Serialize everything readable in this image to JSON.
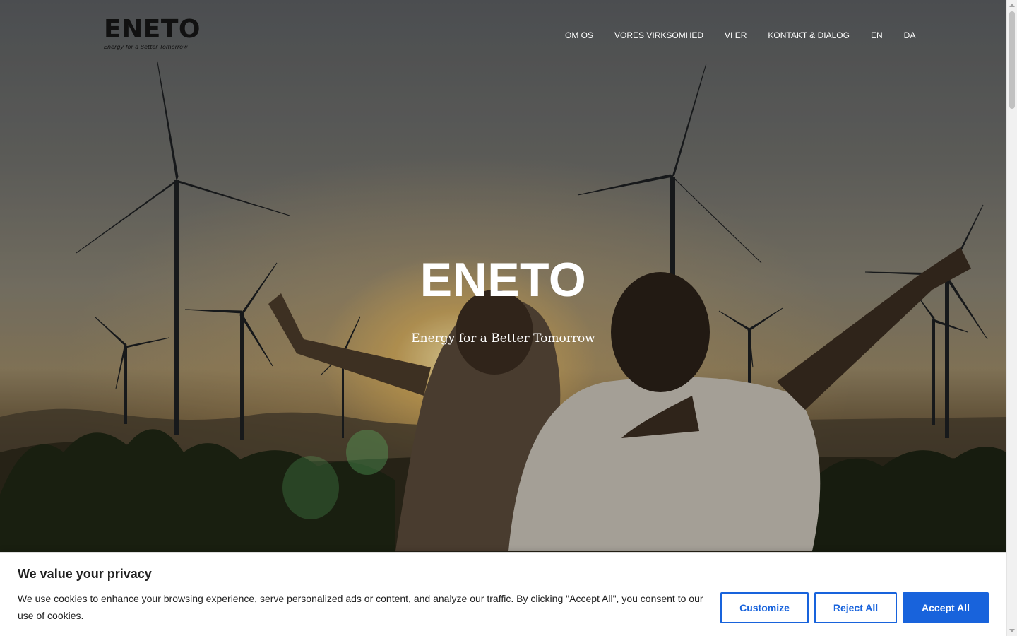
{
  "header": {
    "logo_text": "ENETO",
    "logo_tagline": "Energy for a Better Tomorrow",
    "nav": [
      {
        "label": "OM OS"
      },
      {
        "label": "VORES VIRKSOMHED"
      },
      {
        "label": "VI ER"
      },
      {
        "label": "KONTAKT & DIALOG"
      },
      {
        "label": "EN"
      },
      {
        "label": "DA"
      }
    ]
  },
  "hero": {
    "title": "ENETO",
    "subtitle": "Energy for a Better Tomorrow"
  },
  "cookie_banner": {
    "title": "We value your privacy",
    "text": "We use cookies to enhance your browsing experience, serve personalized ads or content, and analyze our traffic. By clicking \"Accept All\", you consent to our use of cookies.",
    "customize_label": "Customize",
    "reject_label": "Reject All",
    "accept_label": "Accept All"
  },
  "colors": {
    "accent": "#1863dc",
    "text": "#212121"
  }
}
